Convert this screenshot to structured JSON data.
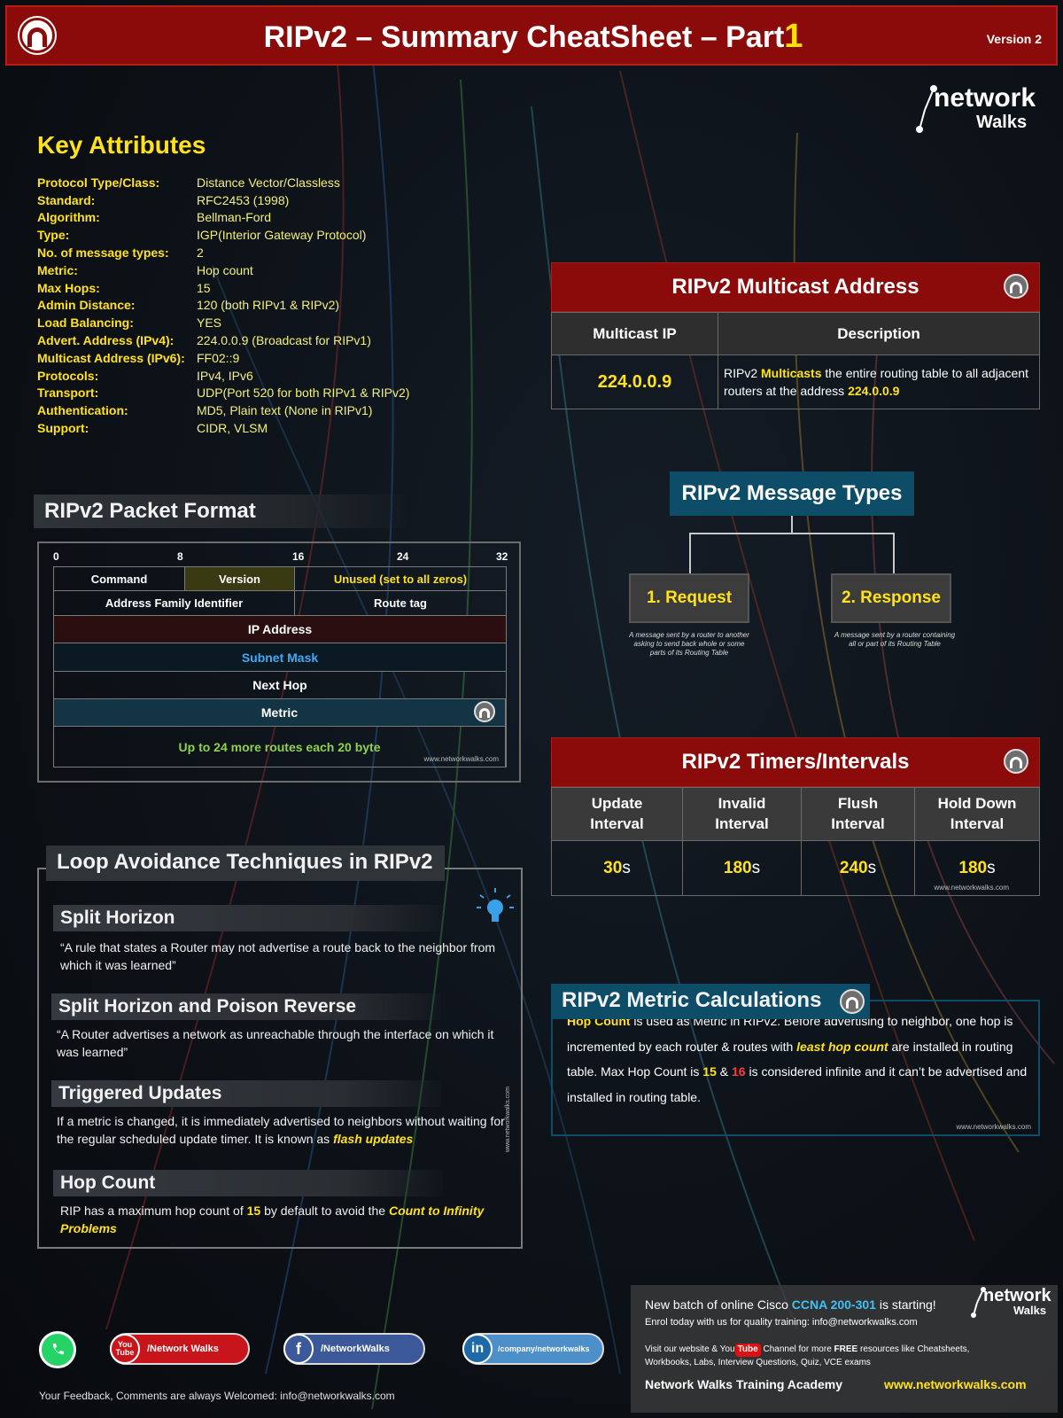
{
  "header": {
    "title_main": "RIPv2 – Summary CheatSheet – Part",
    "title_number": "1",
    "version": "Version 2"
  },
  "brand": {
    "line1": "network",
    "line2": "Walks"
  },
  "key_attributes": {
    "title": "Key Attributes",
    "rows": [
      {
        "label": "Protocol Type/Class:",
        "value": "Distance Vector/Classless"
      },
      {
        "label": "Standard:",
        "value": "RFC2453 (1998)"
      },
      {
        "label": "Algorithm:",
        "value": "Bellman-Ford"
      },
      {
        "label": "Type:",
        "value": "IGP(Interior Gateway Protocol)"
      },
      {
        "label": "No. of message types:",
        "value": "2"
      },
      {
        "label": "Metric:",
        "value": "Hop count"
      },
      {
        "label": "Max Hops:",
        "value": "15"
      },
      {
        "label": "Admin Distance:",
        "value": "120 (both RIPv1 & RIPv2)"
      },
      {
        "label": "Load Balancing:",
        "value": "YES"
      },
      {
        "label": "Advert. Address (IPv4):",
        "value": "224.0.0.9 (Broadcast for RIPv1)"
      },
      {
        "label": "Multicast Address (IPv6):",
        "value": "FF02::9"
      },
      {
        "label": "Protocols:",
        "value": "IPv4, IPv6"
      },
      {
        "label": "Transport:",
        "value": "UDP(Port 520 for both RIPv1 & RIPv2)"
      },
      {
        "label": "Authentication:",
        "value": "MD5, Plain text (None in RIPv1)"
      },
      {
        "label": "Support:",
        "value": "CIDR, VLSM"
      }
    ]
  },
  "packet_format": {
    "title": "RIPv2 Packet Format",
    "bits": [
      "0",
      "8",
      "16",
      "24",
      "32"
    ],
    "command": "Command",
    "version": "Version",
    "unused": "Unused (set to all zeros)",
    "afi": "Address Family Identifier",
    "route_tag": "Route tag",
    "ip_address": "IP Address",
    "subnet_mask": "Subnet Mask",
    "next_hop": "Next Hop",
    "metric": "Metric",
    "more_routes": "Up to 24 more routes each 20 byte",
    "url": "www.networkwalks.com"
  },
  "multicast": {
    "title": "RIPv2 Multicast Address",
    "col1": "Multicast IP",
    "col2": "Description",
    "ip": "224.0.0.9",
    "desc_pre": "RIPv2 ",
    "desc_hl": "Multicasts",
    "desc_mid": " the entire routing table to all adjacent routers at the address ",
    "desc_ip": "224.0.0.9"
  },
  "message_types": {
    "title": "RIPv2 Message Types",
    "request": "1. Request",
    "request_desc": "A message sent by a router to another asking to send back whole or some parts of its Routing Table",
    "response": "2. Response",
    "response_desc": "A message sent by a router containing all or part of its Routing Table"
  },
  "timers": {
    "title": "RIPv2 Timers/Intervals",
    "columns": [
      {
        "h1": "Update",
        "h2": "Interval",
        "num": "30",
        "unit": "s"
      },
      {
        "h1": "Invalid",
        "h2": "Interval",
        "num": "180",
        "unit": "s"
      },
      {
        "h1": "Flush",
        "h2": "Interval",
        "num": "240",
        "unit": "s"
      },
      {
        "h1": "Hold Down",
        "h2": "Interval",
        "num": "180",
        "unit": "s"
      }
    ],
    "url": "www.networkwalks.com"
  },
  "loop": {
    "title": "Loop Avoidance Techniques in RIPv2",
    "split_horizon": "Split Horizon",
    "split_horizon_text": "“A rule that states a Router may not advertise a route back to the neighbor from which it was learned”",
    "poison": "Split Horizon and Poison Reverse",
    "poison_text": "“A Router advertises a network as unreachable through the interface on which it was learned”",
    "triggered": "Triggered Updates",
    "triggered_text": "If a metric is changed, it is immediately advertised to neighbors without waiting for the regular scheduled update timer. It is known as ",
    "triggered_hl": "flash updates",
    "hop": "Hop Count",
    "hop_pre": "RIP has a maximum hop count of ",
    "hop_num": "15",
    "hop_mid": " by default to avoid the ",
    "hop_hl": "Count to Infinity Problems",
    "side_url": "www.networkwalks.com"
  },
  "metric_calc": {
    "title": "RIPv2 Metric Calculations",
    "t1": "Hop Count",
    "t2": " is used as Metric in RIPv2. Before advertising to neighbor, one hop is incremented by each router & routes with ",
    "t3": "least hop count",
    "t4": " are installed in routing table. Max Hop Count is ",
    "t5": "15",
    "t6": " & ",
    "t7": "16",
    "t8": " is considered infinite and it can’t be advertised and installed in routing table.",
    "url": "www.networkwalks.com"
  },
  "footer": {
    "youtube": "/Network Walks",
    "facebook": "/NetworkWalks",
    "linkedin": "/company/networkwalks",
    "feedback": "Your Feedback, Comments are always Welcomed: info@networkwalks.com",
    "batch_pre": "New batch of online Cisco ",
    "batch_hl": "CCNA 200-301",
    "batch_post": " is starting!",
    "enrol": "Enrol today with us for quality training: info@networkwalks.com",
    "visit_pre": "Visit our website & You",
    "visit_tube": "Tube",
    "visit_mid": " Channel for more ",
    "visit_free": "FREE",
    "visit_post": " resources like Cheatsheets, Workbooks, Labs, Interview Questions, Quiz, VCE exams",
    "academy": "Network Walks Training Academy",
    "website": "www.networkwalks.com",
    "yt_badge_top": "You",
    "yt_badge_bottom": "Tube"
  },
  "colors": {
    "header_red": "#8b0b0b",
    "accent_yellow": "#ffe21a",
    "teal": "#0e4d67",
    "subnet_blue": "#3fa9f5",
    "more_routes_green": "#8fd14f"
  }
}
